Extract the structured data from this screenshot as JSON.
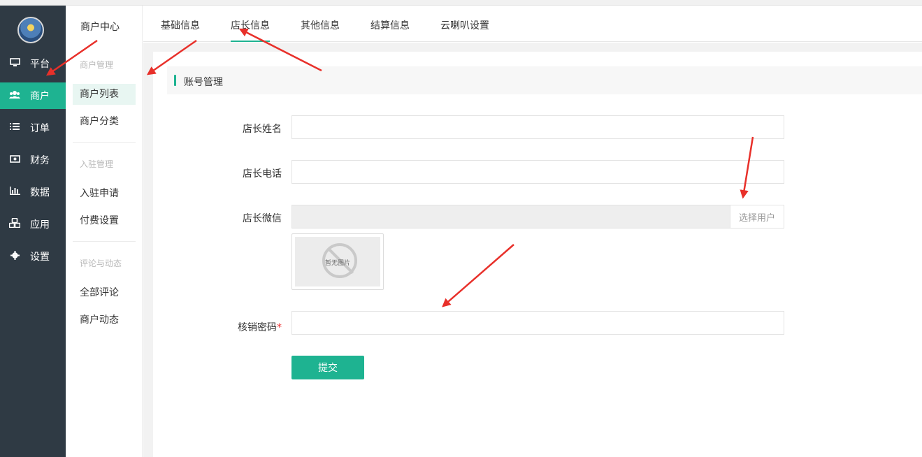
{
  "sidebar": {
    "items": [
      {
        "label": "平台",
        "icon": "monitor-icon"
      },
      {
        "label": "商户",
        "icon": "users-icon"
      },
      {
        "label": "订单",
        "icon": "list-icon"
      },
      {
        "label": "财务",
        "icon": "money-icon"
      },
      {
        "label": "数据",
        "icon": "bar-chart-icon"
      },
      {
        "label": "应用",
        "icon": "cubes-icon"
      },
      {
        "label": "设置",
        "icon": "gear-icon"
      }
    ],
    "active": "商户"
  },
  "subnav": {
    "title": "商户中心",
    "group1": "商户管理",
    "item_list": "商户列表",
    "item_category": "商户分类",
    "group2": "入驻管理",
    "item_apply": "入驻申请",
    "item_fee": "付费设置",
    "group3": "评论与动态",
    "item_comments": "全部评论",
    "item_moments": "商户动态"
  },
  "tabs": [
    "基础信息",
    "店长信息",
    "其他信息",
    "结算信息",
    "云喇叭设置"
  ],
  "active_tab": "店长信息",
  "section": {
    "title": "账号管理"
  },
  "form": {
    "name_label": "店长姓名",
    "phone_label": "店长电话",
    "wechat_label": "店长微信",
    "select_user": "选择用户",
    "no_image": "暂无图片",
    "password_label": "核销密码",
    "required_mark": "*",
    "name_value": "",
    "phone_value": "",
    "wechat_value": "",
    "password_value": "",
    "submit": "提交"
  },
  "colors": {
    "accent": "#1eb391",
    "sidebar_bg": "#2f3a44",
    "annotation_arrow": "#e8302a"
  }
}
